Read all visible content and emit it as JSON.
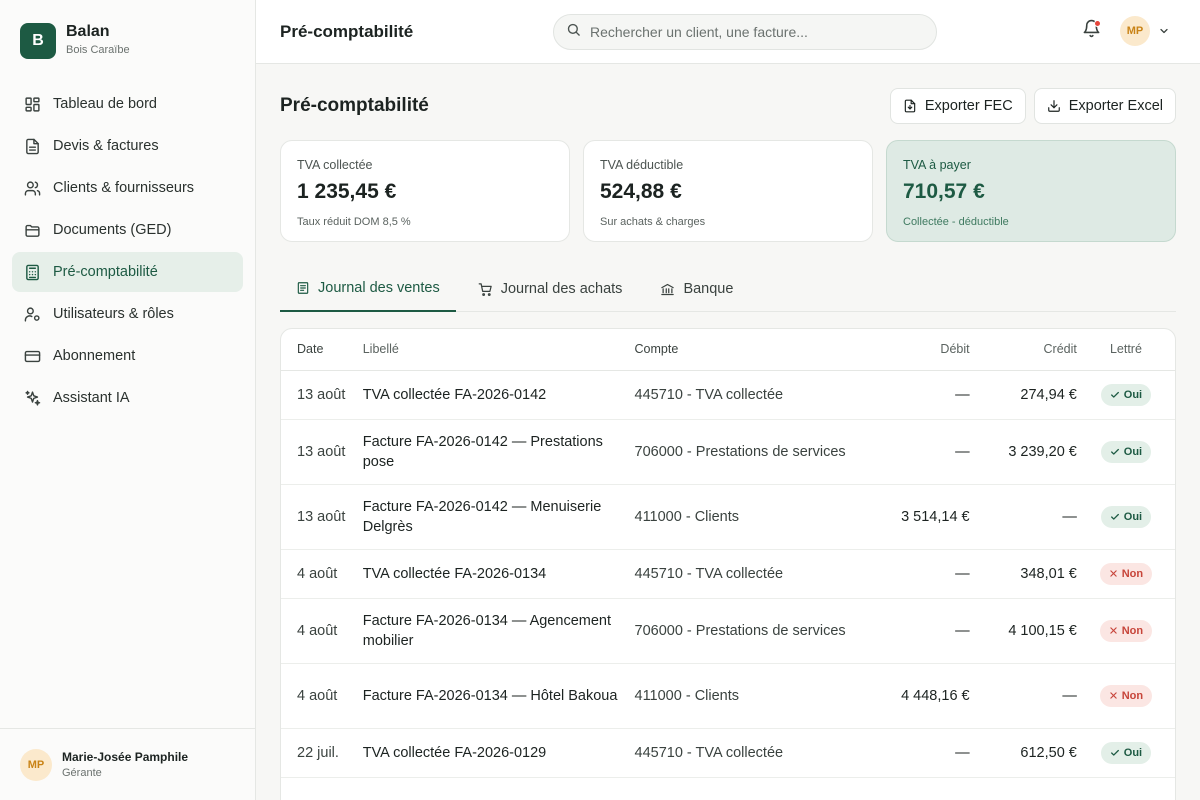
{
  "brand": {
    "initial": "B",
    "name": "Balan",
    "subtitle": "Bois Caraïbe"
  },
  "sidebar": {
    "items": [
      {
        "label": "Tableau de bord",
        "icon": "dashboard-icon"
      },
      {
        "label": "Devis & factures",
        "icon": "document-icon"
      },
      {
        "label": "Clients & fournisseurs",
        "icon": "users-icon"
      },
      {
        "label": "Documents (GED)",
        "icon": "folder-icon"
      },
      {
        "label": "Pré-comptabilité",
        "icon": "calculator-icon",
        "active": true
      },
      {
        "label": "Utilisateurs & rôles",
        "icon": "user-settings-icon"
      },
      {
        "label": "Abonnement",
        "icon": "credit-card-icon"
      },
      {
        "label": "Assistant IA",
        "icon": "sparkles-icon"
      }
    ]
  },
  "user": {
    "initials": "MP",
    "name": "Marie-Josée Pamphile",
    "role": "Gérante"
  },
  "topbar": {
    "title": "Pré-comptabilité",
    "search_placeholder": "Rechercher un client, une facture...",
    "avatar_initials": "MP"
  },
  "page": {
    "title": "Pré-comptabilité",
    "export_fec": "Exporter FEC",
    "export_excel": "Exporter Excel"
  },
  "cards": [
    {
      "label": "TVA collectée",
      "value": "1 235,45 €",
      "sub": "Taux réduit DOM 8,5 %"
    },
    {
      "label": "TVA déductible",
      "value": "524,88 €",
      "sub": "Sur achats & charges"
    },
    {
      "label": "TVA à payer",
      "value": "710,57 €",
      "sub": "Collectée - déductible"
    }
  ],
  "tabs": [
    {
      "label": "Journal des ventes",
      "active": true
    },
    {
      "label": "Journal des achats"
    },
    {
      "label": "Banque"
    }
  ],
  "table": {
    "headers": {
      "date": "Date",
      "libelle": "Libellé",
      "compte": "Compte",
      "debit": "Débit",
      "credit": "Crédit",
      "lettre": "Lettré"
    },
    "rows": [
      {
        "date": "13 août",
        "libelle": "TVA collectée FA-2026-0142",
        "compte": "445710 - TVA collectée",
        "debit": "—",
        "credit": "274,94 €",
        "lettre": "Oui"
      },
      {
        "date": "13 août",
        "libelle": "Facture FA-2026-0142 — Prestations pose",
        "compte": "706000 - Prestations de services",
        "debit": "—",
        "credit": "3 239,20 €",
        "lettre": "Oui"
      },
      {
        "date": "13 août",
        "libelle": "Facture FA-2026-0142 — Menuiserie Delgrès",
        "compte": "411000 - Clients",
        "debit": "3 514,14 €",
        "credit": "—",
        "lettre": "Oui"
      },
      {
        "date": "4 août",
        "libelle": "TVA collectée FA-2026-0134",
        "compte": "445710 - TVA collectée",
        "debit": "—",
        "credit": "348,01 €",
        "lettre": "Non"
      },
      {
        "date": "4 août",
        "libelle": "Facture FA-2026-0134 — Agencement mobilier",
        "compte": "706000 - Prestations de services",
        "debit": "—",
        "credit": "4 100,15 €",
        "lettre": "Non"
      },
      {
        "date": "4 août",
        "libelle": "Facture FA-2026-0134 — Hôtel Bakoua",
        "compte": "411000 - Clients",
        "debit": "4 448,16 €",
        "credit": "—",
        "lettre": "Non"
      },
      {
        "date": "22 juil.",
        "libelle": "TVA collectée FA-2026-0129",
        "compte": "445710 - TVA collectée",
        "debit": "—",
        "credit": "612,50 €",
        "lettre": "Oui"
      }
    ]
  },
  "colors": {
    "primary": "#1d5a43",
    "accent_bg": "#deeae4",
    "badge_yes": "#e3efe8",
    "badge_no": "#fbe6e3",
    "notif_dot": "#e5453a"
  }
}
